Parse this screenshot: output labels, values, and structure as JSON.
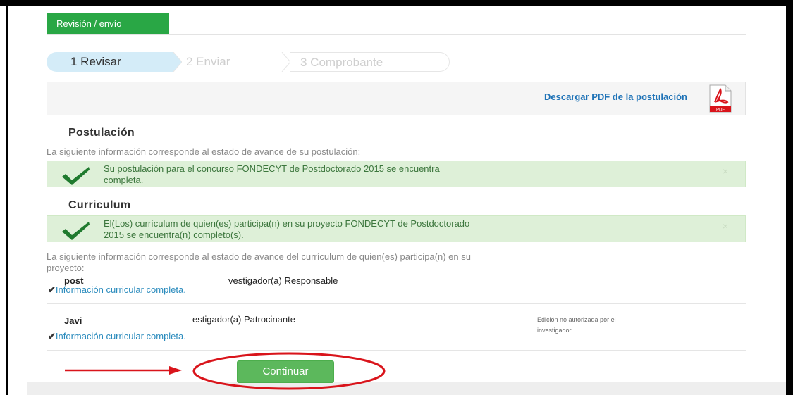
{
  "tab": {
    "label": "Revisión / envío"
  },
  "steps": [
    {
      "label": "1 Revisar"
    },
    {
      "label": "2 Enviar"
    },
    {
      "label": "3 Comprobante"
    }
  ],
  "pdf": {
    "link_text": "Descargar PDF de la postulación",
    "icon": "pdf-file-icon",
    "icon_text": "PDF"
  },
  "postulacion": {
    "heading": "Postulación",
    "intro": "La siguiente información corresponde al estado de avance de su postulación:",
    "alert_line1": "Su postulación para el concurso FONDECYT de Postdoctorado 2015 se encuentra",
    "alert_line2": "completa.",
    "close": "×"
  },
  "curriculum": {
    "heading": "Curriculum",
    "alert_line1": "El(Los) currículum de quien(es) participa(n) en su proyecto FONDECYT de Postdoctorado",
    "alert_line2": "2015 se encuentra(n) completo(s).",
    "close": "×",
    "intro_line1": "La siguiente información corresponde al estado de avance del currículum de quien(es) participa(n) en su",
    "intro_line2": "proyecto:",
    "people": [
      {
        "name": "post",
        "role": "vestigador(a) Responsable",
        "status": "Información curricular completa.",
        "note_line1": "",
        "note_line2": ""
      },
      {
        "name": "Javi",
        "role": "estigador(a) Patrocinante",
        "status": "Información curricular completa.",
        "note_line1": "Edición no autorizada por el",
        "note_line2": "investigador."
      }
    ]
  },
  "continue_button": {
    "label": "Continuar"
  },
  "colors": {
    "primary_green": "#5cb85c",
    "tab_green": "#29a745",
    "link_blue": "#1f73b7",
    "annotation_red": "#d9141b"
  }
}
